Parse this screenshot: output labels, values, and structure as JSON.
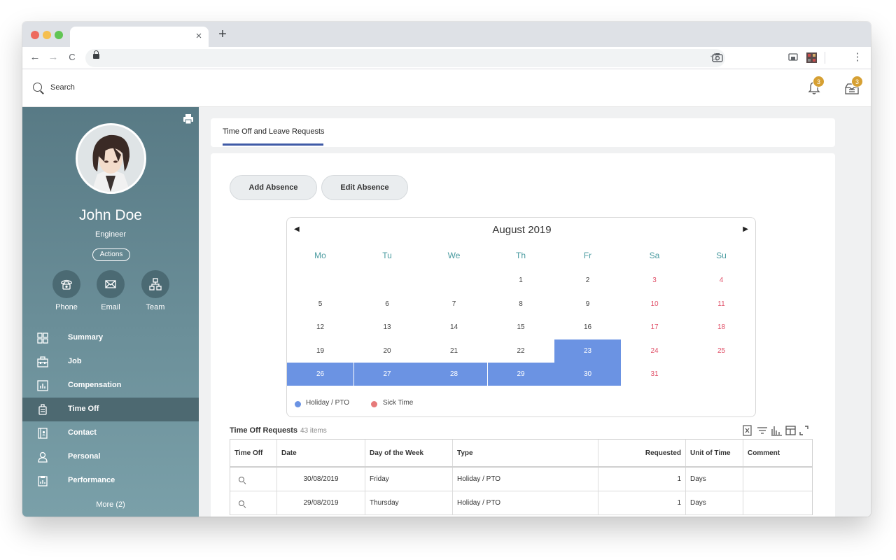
{
  "browser": {
    "tab_close": "×",
    "new_tab": "+",
    "back": "←",
    "forward": "→",
    "reload": "C",
    "star": "☆",
    "menu": "⋮"
  },
  "header": {
    "search_label": "Search",
    "notifications_count": "3",
    "inbox_count": "3"
  },
  "profile": {
    "name": "John Doe",
    "role": "Engineer",
    "actions_label": "Actions",
    "quick_actions": [
      {
        "label": "Phone",
        "icon": "phone-icon"
      },
      {
        "label": "Email",
        "icon": "mail-icon"
      },
      {
        "label": "Team",
        "icon": "org-chart-icon"
      }
    ]
  },
  "sidebar": {
    "items": [
      {
        "label": "Summary",
        "icon": "grid-icon",
        "active": false
      },
      {
        "label": "Job",
        "icon": "briefcase-icon",
        "active": false
      },
      {
        "label": "Compensation",
        "icon": "chart-icon",
        "active": false
      },
      {
        "label": "Time Off",
        "icon": "suitcase-icon",
        "active": true
      },
      {
        "label": "Contact",
        "icon": "address-book-icon",
        "active": false
      },
      {
        "label": "Personal",
        "icon": "person-icon",
        "active": false
      },
      {
        "label": "Performance",
        "icon": "clipboard-icon",
        "active": false
      }
    ],
    "more_label": "More (2)"
  },
  "page": {
    "tab_label": "Time Off and Leave Requests",
    "add_absence": "Add Absence",
    "edit_absence": "Edit Absence"
  },
  "calendar": {
    "prev": "◀",
    "next": "▶",
    "title": "August 2019",
    "weekdays": [
      "Mo",
      "Tu",
      "We",
      "Th",
      "Fr",
      "Sa",
      "Su"
    ],
    "weeks": [
      [
        "",
        "",
        "",
        "1",
        "2",
        "3",
        "4"
      ],
      [
        "5",
        "6",
        "7",
        "8",
        "9",
        "10",
        "11"
      ],
      [
        "12",
        "13",
        "14",
        "15",
        "16",
        "17",
        "18"
      ],
      [
        "19",
        "20",
        "21",
        "22",
        "23",
        "24",
        "25"
      ],
      [
        "26",
        "27",
        "28",
        "29",
        "30",
        "31",
        ""
      ]
    ],
    "holiday_days": [
      "23",
      "26",
      "27",
      "28",
      "29",
      "30"
    ],
    "legend": [
      {
        "label": "Holiday / PTO",
        "color": "#6b93e3"
      },
      {
        "label": "Sick Time",
        "color": "#e67a7a"
      }
    ],
    "colors": {
      "weekday_header": "#4a9ba0",
      "weekend": "#e05068",
      "holiday": "#6b93e3"
    }
  },
  "requests": {
    "title": "Time Off Requests",
    "count": "43 items",
    "columns": [
      "Time Off",
      "Date",
      "Day of the Week",
      "Type",
      "Requested",
      "Unit of Time",
      "Comment"
    ],
    "rows": [
      {
        "date": "30/08/2019",
        "day": "Friday",
        "type": "Holiday / PTO",
        "requested": "1",
        "unit": "Days",
        "comment": ""
      },
      {
        "date": "29/08/2019",
        "day": "Thursday",
        "type": "Holiday / PTO",
        "requested": "1",
        "unit": "Days",
        "comment": ""
      }
    ]
  }
}
